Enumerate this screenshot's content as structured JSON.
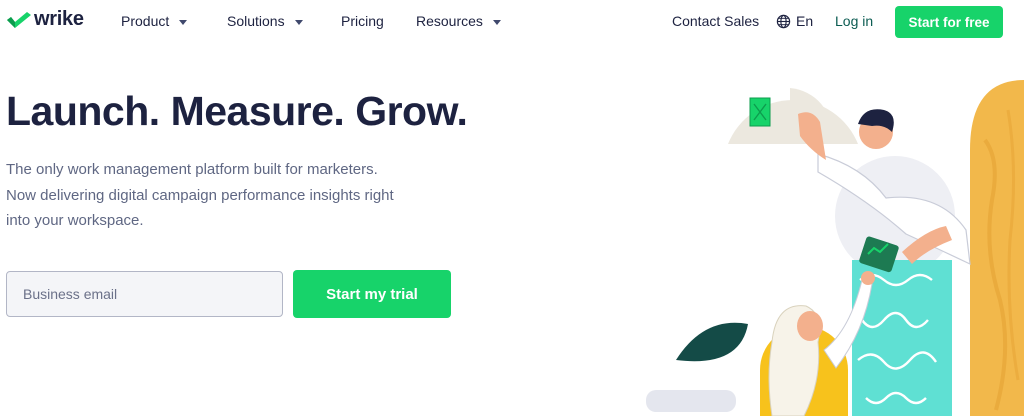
{
  "nav": {
    "logo_text": "wrike",
    "logo_icon": "wrike-checkmark-icon",
    "items": [
      {
        "label": "Product",
        "has_dropdown": true
      },
      {
        "label": "Solutions",
        "has_dropdown": true
      },
      {
        "label": "Pricing",
        "has_dropdown": false
      },
      {
        "label": "Resources",
        "has_dropdown": true
      }
    ],
    "contact_sales": "Contact Sales",
    "language": "En",
    "language_icon": "globe-icon",
    "login": "Log in",
    "cta": "Start for free"
  },
  "hero": {
    "title": "Launch. Measure. Grow.",
    "subtitle_lines": [
      "The only work management platform built for marketers.",
      "Now delivering digital campaign performance insights right",
      "into your workspace."
    ],
    "email_placeholder": "Business email",
    "email_value": "",
    "trial_button": "Start my trial"
  },
  "colors": {
    "brand_green": "#17d36a",
    "text_navy": "#1d2240",
    "subtitle_gray": "#5f6783",
    "login_teal": "#0b5c52"
  }
}
